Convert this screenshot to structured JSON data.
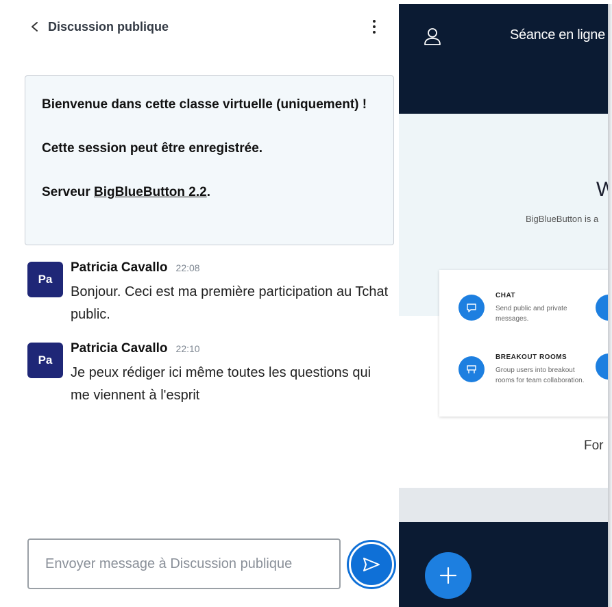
{
  "chat": {
    "title": "Discussion publique",
    "welcome": {
      "line1": "Bienvenue dans cette classe virtuelle (uniquement) !",
      "line2": "Cette session peut être enregistrée.",
      "line3_prefix": "Serveur ",
      "line3_link": "BigBlueButton 2.2",
      "line3_suffix": "."
    },
    "messages": [
      {
        "avatar": "Pa",
        "author": "Patricia Cavallo",
        "time": "22:08",
        "text": "Bonjour. Ceci est ma première participation au Tchat public."
      },
      {
        "avatar": "Pa",
        "author": "Patricia Cavallo",
        "time": "22:10",
        "text": "Je peux rédiger ici même toutes les questions qui me viennent à l'esprit"
      }
    ],
    "input": {
      "placeholder": "Envoyer message à Discussion publique",
      "value": ""
    }
  },
  "presentation": {
    "session_title": "Séance en ligne",
    "slide": {
      "title": "W",
      "subtitle": "BigBlueButton is a",
      "features": [
        {
          "title": "CHAT",
          "desc": "Send public and private messages."
        },
        {
          "title": "BREAKOUT ROOMS",
          "desc": "Group users into breakout rooms for team collaboration."
        }
      ],
      "more": "For"
    }
  },
  "icons": {
    "back": "chevron-left-icon",
    "more": "vertical-dots-icon",
    "send": "send-icon",
    "user": "user-icon",
    "add": "plus-icon"
  },
  "colors": {
    "avatar_bg": "#1f2777",
    "accent": "#0f70d7",
    "dark_bg": "#0b1b33",
    "welcome_bg": "#f3f8fb"
  }
}
